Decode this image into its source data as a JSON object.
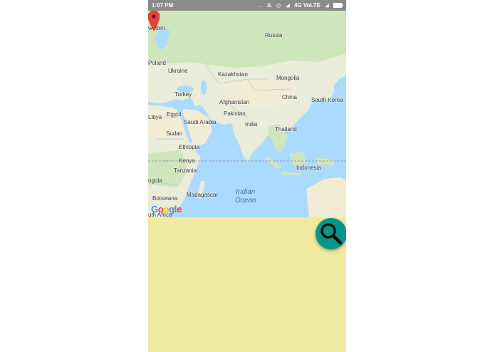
{
  "status_bar": {
    "time": "1:07 PM",
    "dots": "...",
    "network": "4G VoLTE",
    "icons": [
      "mute-icon",
      "alarm-icon",
      "signal-icon",
      "wifi-icon",
      "signal-icon",
      "battery-icon"
    ]
  },
  "map": {
    "labels": {
      "russia": "Russia",
      "sweden": "weden",
      "poland": "Poland",
      "ukraine": "Ukraine",
      "kazakhstan": "Kazakhstan",
      "mongolia": "Mongolia",
      "turkey": "Turkey",
      "afghanistan": "Afghanistan",
      "china": "China",
      "south_korea": "South Korea",
      "libya": "Libya",
      "egypt": "Egypt",
      "pakistan": "Pakistan",
      "saudi_arabia": "Saudi Arabia",
      "india": "India",
      "thailand": "Thailand",
      "sudan": "Sudan",
      "ethiopia": "Ethiopia",
      "kenya": "Kenya",
      "indonesia": "Indonesia",
      "tanzania": "Tanzania",
      "angola": "ngola",
      "botswana": "Botswana",
      "madagascar": "Madagascar",
      "indian_ocean_1": "Indian",
      "indian_ocean_2": "Ocean",
      "south_africa": "uth Africa"
    },
    "attribution": "Google",
    "colors": {
      "land": "#e8ecd9",
      "forest": "#cfe5bb",
      "desert": "#f2ecd4",
      "water": "#aadaff",
      "marker": "#ea4335"
    }
  },
  "fab": {
    "icon": "search-icon",
    "color": "#049688"
  },
  "background_color": "#f0e9a0"
}
